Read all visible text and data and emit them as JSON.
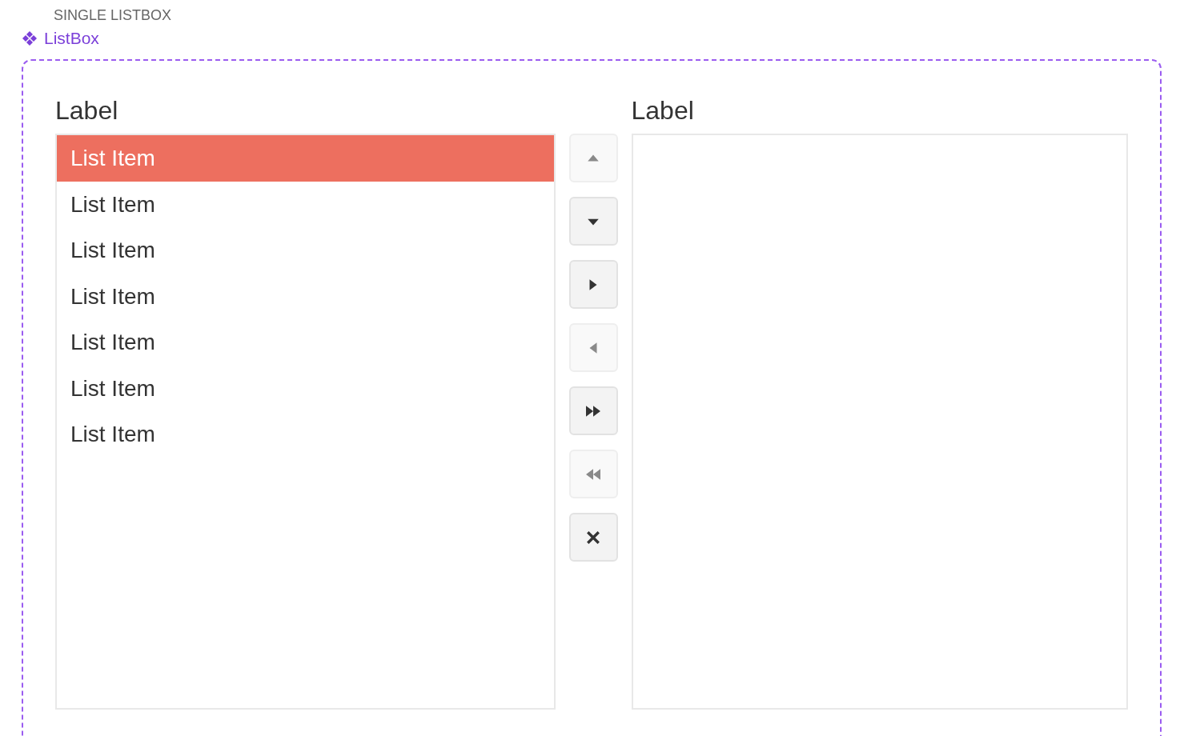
{
  "section_title": "SINGLE LISTBOX",
  "component": {
    "name": "ListBox"
  },
  "source": {
    "label": "Label",
    "items": [
      {
        "text": "List Item",
        "selected": true
      },
      {
        "text": "List Item",
        "selected": false
      },
      {
        "text": "List Item",
        "selected": false
      },
      {
        "text": "List Item",
        "selected": false
      },
      {
        "text": "List Item",
        "selected": false
      },
      {
        "text": "List Item",
        "selected": false
      },
      {
        "text": "List Item",
        "selected": false
      }
    ]
  },
  "controls": [
    {
      "kind": "up",
      "disabled": true
    },
    {
      "kind": "down",
      "disabled": false
    },
    {
      "kind": "right",
      "disabled": false
    },
    {
      "kind": "left",
      "disabled": true
    },
    {
      "kind": "all-right",
      "disabled": false
    },
    {
      "kind": "all-left",
      "disabled": true
    },
    {
      "kind": "clear",
      "disabled": false
    }
  ],
  "target": {
    "label": "Label"
  }
}
